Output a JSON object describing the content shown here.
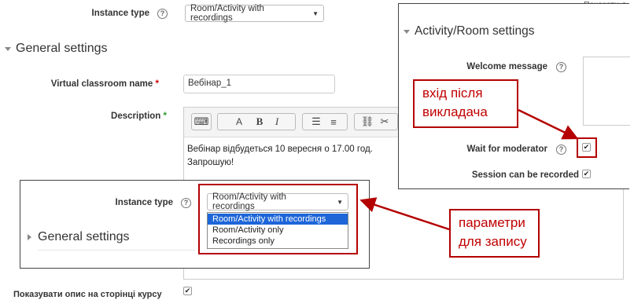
{
  "top": {
    "instance_type_label": "Instance type",
    "instance_type_value": "Room/Activity with recordings",
    "show_link": "Показати д"
  },
  "general": {
    "title": "General settings",
    "name_label": "Virtual classroom name",
    "name_value": "Вебінар_1",
    "description_label": "Description",
    "description_text_1": "Вебінар відбудеться 10 вересня о 17.00 год.",
    "description_text_2": "Запрошую!",
    "show_desc_label": "Показувати опис на сторінці курсу"
  },
  "toolbar": {
    "keyboard_icon": "⌨",
    "font_icon": "A",
    "bold": "B",
    "italic": "I",
    "bullets_icon": "☰",
    "numbers_icon": "≡",
    "link_icon": "⛓",
    "unlink_icon": "✂"
  },
  "right_panel": {
    "title": "Activity/Room settings",
    "welcome_label": "Welcome message",
    "wait_label": "Wait for moderator",
    "record_label": "Session can be recorded"
  },
  "left_panel": {
    "instance_type_label": "Instance type",
    "instance_type_value": "Room/Activity with recordings",
    "options": [
      "Room/Activity with recordings",
      "Room/Activity only",
      "Recordings only"
    ],
    "general_title": "General settings"
  },
  "callouts": {
    "moderator_1": "вхід після",
    "moderator_2": "викладача",
    "recording_1": "параметри",
    "recording_2": "для запису"
  },
  "colors": {
    "callout_red": "#b40000",
    "selected_blue": "#1e66d8"
  }
}
